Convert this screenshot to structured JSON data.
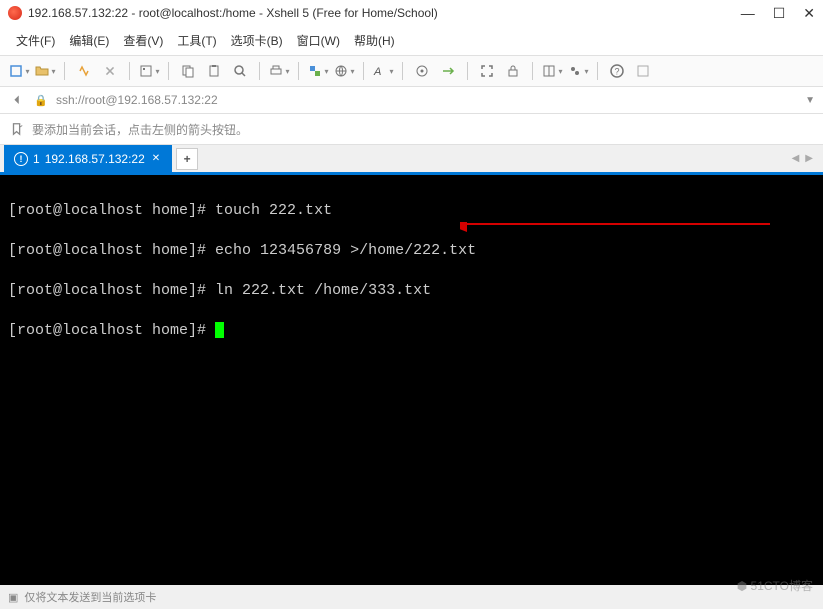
{
  "window": {
    "title": "192.168.57.132:22 - root@localhost:/home - Xshell 5 (Free for Home/School)"
  },
  "menu": {
    "file": "文件(F)",
    "edit": "编辑(E)",
    "view": "查看(V)",
    "tools": "工具(T)",
    "tabs": "选项卡(B)",
    "window": "窗口(W)",
    "help": "帮助(H)"
  },
  "address": {
    "url": "ssh://root@192.168.57.132:22"
  },
  "info": {
    "hint": "要添加当前会话，点击左侧的箭头按钮。"
  },
  "tab": {
    "index": "1",
    "label": "192.168.57.132:22",
    "add": "+"
  },
  "terminal": {
    "lines": [
      {
        "prompt": "[root@localhost home]# ",
        "cmd": "touch 222.txt"
      },
      {
        "prompt": "[root@localhost home]# ",
        "cmd": "echo 123456789 >/home/222.txt"
      },
      {
        "prompt": "[root@localhost home]# ",
        "cmd": "ln 222.txt /home/333.txt"
      },
      {
        "prompt": "[root@localhost home]# ",
        "cmd": ""
      }
    ]
  },
  "status": {
    "text": "仅将文本发送到当前选项卡"
  },
  "watermark": "51CTO博客"
}
